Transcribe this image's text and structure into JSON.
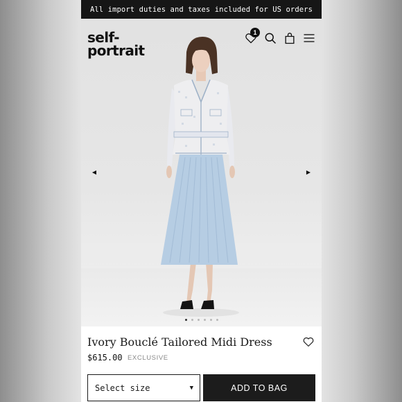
{
  "promo": {
    "text": "All import duties and taxes included for US orders"
  },
  "header": {
    "logo_line1": "self-",
    "logo_line2": "portrait",
    "wishlist_count": "1",
    "icons": [
      "heart-icon",
      "search-icon",
      "shopping-bag-icon",
      "menu-icon"
    ]
  },
  "gallery": {
    "prev_arrow": "◀",
    "next_arrow": "▶",
    "slide_count": 6,
    "active_slide": 1
  },
  "product": {
    "name": "Ivory Bouclé Tailored Midi Dress",
    "price": "$615.00",
    "tag": "EXCLUSIVE"
  },
  "actions": {
    "size_placeholder": "Select size",
    "size_caret": "▼",
    "add_to_bag": "ADD TO BAG"
  },
  "colors": {
    "bar": "#161616",
    "button": "#1c1c1c",
    "skirt": "#b6cde3",
    "jacket": "#eeeef0"
  }
}
